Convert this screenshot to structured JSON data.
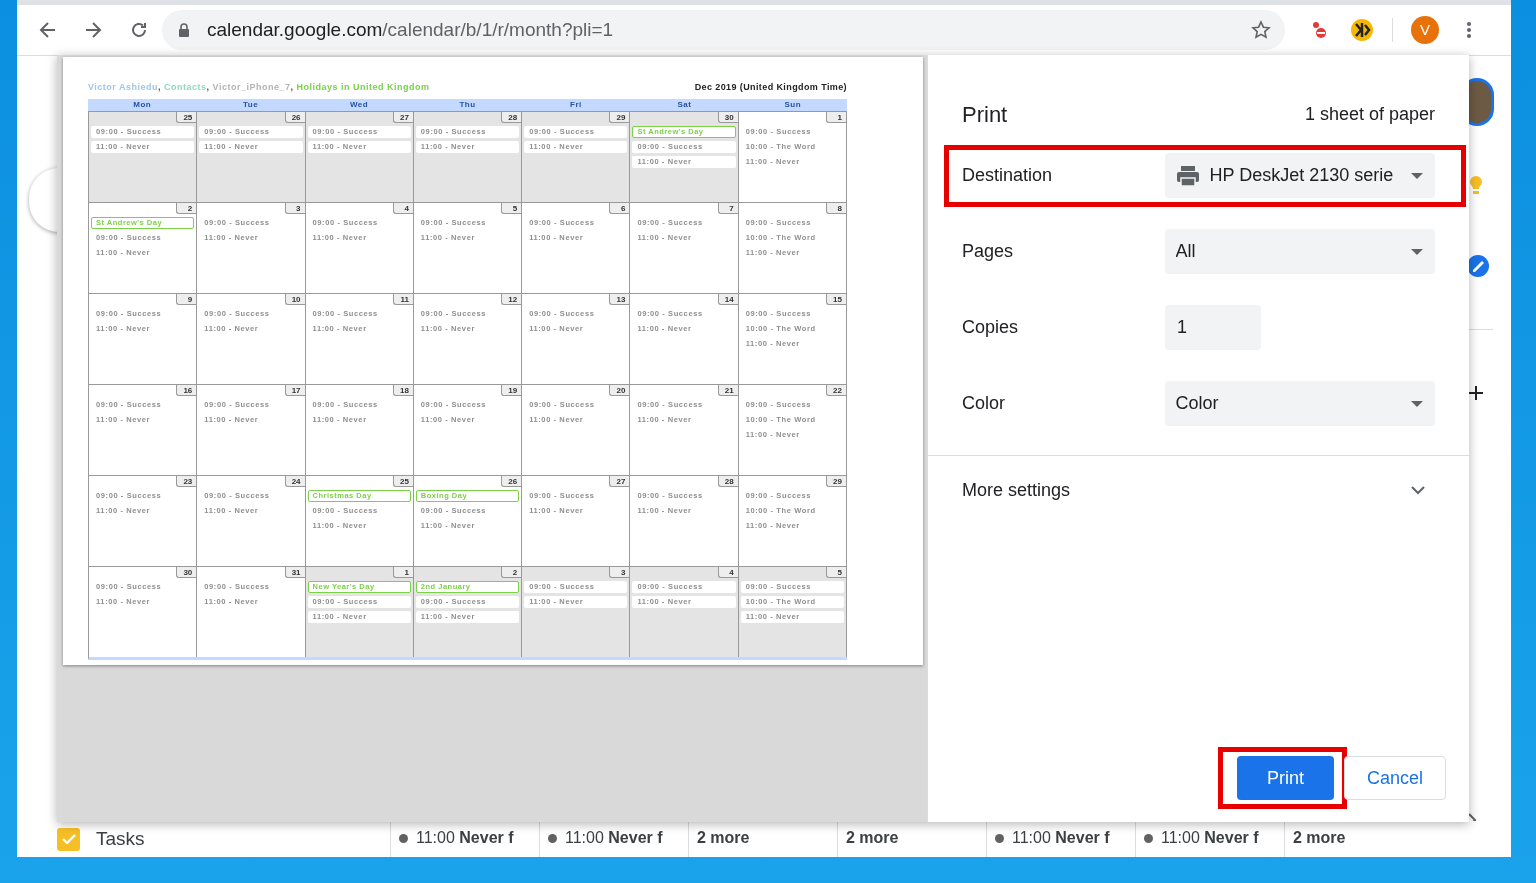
{
  "browser": {
    "url_host": "calendar.google.com",
    "url_path": "/calendar/b/1/r/month?pli=1",
    "profile_initial": "V"
  },
  "preview": {
    "calendars": [
      {
        "name": "Victor Ashiedu",
        "color": "#9fc6e7"
      },
      {
        "name": "Contacts",
        "color": "#8ed9c3"
      },
      {
        "name": "Victor_iPhone_7",
        "color": "#b3b3b3"
      },
      {
        "name": "Holidays in United Kingdom",
        "color": "#7bd148"
      }
    ],
    "calendar_separator": ", ",
    "month_title": "Dec 2019 (United Kingdom Time)",
    "weekdays": [
      "Mon",
      "Tue",
      "Wed",
      "Thu",
      "Fri",
      "Sat",
      "Sun"
    ],
    "weeks": [
      [
        {
          "date": "25",
          "other_month": true,
          "events": [
            {
              "kind": "event",
              "text": "09:00 - Success"
            },
            {
              "kind": "event",
              "text": "11:00 - Never"
            }
          ]
        },
        {
          "date": "26",
          "other_month": true,
          "events": [
            {
              "kind": "event",
              "text": "09:00 - Success"
            },
            {
              "kind": "event",
              "text": "11:00 - Never"
            }
          ]
        },
        {
          "date": "27",
          "other_month": true,
          "events": [
            {
              "kind": "event",
              "text": "09:00 - Success"
            },
            {
              "kind": "event",
              "text": "11:00 - Never"
            }
          ]
        },
        {
          "date": "28",
          "other_month": true,
          "events": [
            {
              "kind": "event",
              "text": "09:00 - Success"
            },
            {
              "kind": "event",
              "text": "11:00 - Never"
            }
          ]
        },
        {
          "date": "29",
          "other_month": true,
          "events": [
            {
              "kind": "event",
              "text": "09:00 - Success"
            },
            {
              "kind": "event",
              "text": "11:00 - Never"
            }
          ]
        },
        {
          "date": "30",
          "other_month": true,
          "events": [
            {
              "kind": "holiday",
              "text": "St Andrew's Day"
            },
            {
              "kind": "event",
              "text": "09:00 - Success"
            },
            {
              "kind": "event",
              "text": "11:00 - Never"
            }
          ]
        },
        {
          "date": "1",
          "other_month": false,
          "events": [
            {
              "kind": "event",
              "text": "09:00 - Success"
            },
            {
              "kind": "event",
              "text": "10:00 - The Word"
            },
            {
              "kind": "event",
              "text": "11:00 - Never"
            }
          ]
        }
      ],
      [
        {
          "date": "2",
          "other_month": false,
          "events": [
            {
              "kind": "holiday",
              "text": "St Andrew's Day"
            },
            {
              "kind": "event",
              "text": "09:00 - Success"
            },
            {
              "kind": "event",
              "text": "11:00 - Never"
            }
          ]
        },
        {
          "date": "3",
          "other_month": false,
          "events": [
            {
              "kind": "event",
              "text": "09:00 - Success"
            },
            {
              "kind": "event",
              "text": "11:00 - Never"
            }
          ]
        },
        {
          "date": "4",
          "other_month": false,
          "events": [
            {
              "kind": "event",
              "text": "09:00 - Success"
            },
            {
              "kind": "event",
              "text": "11:00 - Never"
            }
          ]
        },
        {
          "date": "5",
          "other_month": false,
          "events": [
            {
              "kind": "event",
              "text": "09:00 - Success"
            },
            {
              "kind": "event",
              "text": "11:00 - Never"
            }
          ]
        },
        {
          "date": "6",
          "other_month": false,
          "events": [
            {
              "kind": "event",
              "text": "09:00 - Success"
            },
            {
              "kind": "event",
              "text": "11:00 - Never"
            }
          ]
        },
        {
          "date": "7",
          "other_month": false,
          "events": [
            {
              "kind": "event",
              "text": "09:00 - Success"
            },
            {
              "kind": "event",
              "text": "11:00 - Never"
            }
          ]
        },
        {
          "date": "8",
          "other_month": false,
          "events": [
            {
              "kind": "event",
              "text": "09:00 - Success"
            },
            {
              "kind": "event",
              "text": "10:00 - The Word"
            },
            {
              "kind": "event",
              "text": "11:00 - Never"
            }
          ]
        }
      ],
      [
        {
          "date": "9",
          "other_month": false,
          "events": [
            {
              "kind": "event",
              "text": "09:00 - Success"
            },
            {
              "kind": "event",
              "text": "11:00 - Never"
            }
          ]
        },
        {
          "date": "10",
          "other_month": false,
          "events": [
            {
              "kind": "event",
              "text": "09:00 - Success"
            },
            {
              "kind": "event",
              "text": "11:00 - Never"
            }
          ]
        },
        {
          "date": "11",
          "other_month": false,
          "events": [
            {
              "kind": "event",
              "text": "09:00 - Success"
            },
            {
              "kind": "event",
              "text": "11:00 - Never"
            }
          ]
        },
        {
          "date": "12",
          "other_month": false,
          "events": [
            {
              "kind": "event",
              "text": "09:00 - Success"
            },
            {
              "kind": "event",
              "text": "11:00 - Never"
            }
          ]
        },
        {
          "date": "13",
          "other_month": false,
          "events": [
            {
              "kind": "event",
              "text": "09:00 - Success"
            },
            {
              "kind": "event",
              "text": "11:00 - Never"
            }
          ]
        },
        {
          "date": "14",
          "other_month": false,
          "events": [
            {
              "kind": "event",
              "text": "09:00 - Success"
            },
            {
              "kind": "event",
              "text": "11:00 - Never"
            }
          ]
        },
        {
          "date": "15",
          "other_month": false,
          "events": [
            {
              "kind": "event",
              "text": "09:00 - Success"
            },
            {
              "kind": "event",
              "text": "10:00 - The Word"
            },
            {
              "kind": "event",
              "text": "11:00 - Never"
            }
          ]
        }
      ],
      [
        {
          "date": "16",
          "other_month": false,
          "events": [
            {
              "kind": "event",
              "text": "09:00 - Success"
            },
            {
              "kind": "event",
              "text": "11:00 - Never"
            }
          ]
        },
        {
          "date": "17",
          "other_month": false,
          "events": [
            {
              "kind": "event",
              "text": "09:00 - Success"
            },
            {
              "kind": "event",
              "text": "11:00 - Never"
            }
          ]
        },
        {
          "date": "18",
          "other_month": false,
          "events": [
            {
              "kind": "event",
              "text": "09:00 - Success"
            },
            {
              "kind": "event",
              "text": "11:00 - Never"
            }
          ]
        },
        {
          "date": "19",
          "other_month": false,
          "events": [
            {
              "kind": "event",
              "text": "09:00 - Success"
            },
            {
              "kind": "event",
              "text": "11:00 - Never"
            }
          ]
        },
        {
          "date": "20",
          "other_month": false,
          "events": [
            {
              "kind": "event",
              "text": "09:00 - Success"
            },
            {
              "kind": "event",
              "text": "11:00 - Never"
            }
          ]
        },
        {
          "date": "21",
          "other_month": false,
          "events": [
            {
              "kind": "event",
              "text": "09:00 - Success"
            },
            {
              "kind": "event",
              "text": "11:00 - Never"
            }
          ]
        },
        {
          "date": "22",
          "other_month": false,
          "events": [
            {
              "kind": "event",
              "text": "09:00 - Success"
            },
            {
              "kind": "event",
              "text": "10:00 - The Word"
            },
            {
              "kind": "event",
              "text": "11:00 - Never"
            }
          ]
        }
      ],
      [
        {
          "date": "23",
          "other_month": false,
          "events": [
            {
              "kind": "event",
              "text": "09:00 - Success"
            },
            {
              "kind": "event",
              "text": "11:00 - Never"
            }
          ]
        },
        {
          "date": "24",
          "other_month": false,
          "events": [
            {
              "kind": "event",
              "text": "09:00 - Success"
            },
            {
              "kind": "event",
              "text": "11:00 - Never"
            }
          ]
        },
        {
          "date": "25",
          "other_month": false,
          "events": [
            {
              "kind": "holiday",
              "text": "Christmas Day"
            },
            {
              "kind": "event",
              "text": "09:00 - Success"
            },
            {
              "kind": "event",
              "text": "11:00 - Never"
            }
          ]
        },
        {
          "date": "26",
          "other_month": false,
          "events": [
            {
              "kind": "holiday",
              "text": "Boxing Day"
            },
            {
              "kind": "event",
              "text": "09:00 - Success"
            },
            {
              "kind": "event",
              "text": "11:00 - Never"
            }
          ]
        },
        {
          "date": "27",
          "other_month": false,
          "events": [
            {
              "kind": "event",
              "text": "09:00 - Success"
            },
            {
              "kind": "event",
              "text": "11:00 - Never"
            }
          ]
        },
        {
          "date": "28",
          "other_month": false,
          "events": [
            {
              "kind": "event",
              "text": "09:00 - Success"
            },
            {
              "kind": "event",
              "text": "11:00 - Never"
            }
          ]
        },
        {
          "date": "29",
          "other_month": false,
          "events": [
            {
              "kind": "event",
              "text": "09:00 - Success"
            },
            {
              "kind": "event",
              "text": "10:00 - The Word"
            },
            {
              "kind": "event",
              "text": "11:00 - Never"
            }
          ]
        }
      ],
      [
        {
          "date": "30",
          "other_month": false,
          "events": [
            {
              "kind": "event",
              "text": "09:00 - Success"
            },
            {
              "kind": "event",
              "text": "11:00 - Never"
            }
          ]
        },
        {
          "date": "31",
          "other_month": false,
          "events": [
            {
              "kind": "event",
              "text": "09:00 - Success"
            },
            {
              "kind": "event",
              "text": "11:00 - Never"
            }
          ]
        },
        {
          "date": "1",
          "other_month": true,
          "events": [
            {
              "kind": "holiday",
              "text": "New Year's Day"
            },
            {
              "kind": "event",
              "text": "09:00 - Success"
            },
            {
              "kind": "event",
              "text": "11:00 - Never"
            }
          ]
        },
        {
          "date": "2",
          "other_month": true,
          "events": [
            {
              "kind": "holiday",
              "text": "2nd January"
            },
            {
              "kind": "event",
              "text": "09:00 - Success"
            },
            {
              "kind": "event",
              "text": "11:00 - Never"
            }
          ]
        },
        {
          "date": "3",
          "other_month": true,
          "events": [
            {
              "kind": "event",
              "text": "09:00 - Success"
            },
            {
              "kind": "event",
              "text": "11:00 - Never"
            }
          ]
        },
        {
          "date": "4",
          "other_month": true,
          "events": [
            {
              "kind": "event",
              "text": "09:00 - Success"
            },
            {
              "kind": "event",
              "text": "11:00 - Never"
            }
          ]
        },
        {
          "date": "5",
          "other_month": true,
          "events": [
            {
              "kind": "event",
              "text": "09:00 - Success"
            },
            {
              "kind": "event",
              "text": "10:00 - The Word"
            },
            {
              "kind": "event",
              "text": "11:00 - Never"
            }
          ]
        }
      ]
    ]
  },
  "print_panel": {
    "title": "Print",
    "sheet_count": "1 sheet of paper",
    "settings": [
      {
        "kind": "printer",
        "label": "Destination",
        "value": "HP DeskJet 2130 serie",
        "highlighted": true
      },
      {
        "kind": "dropdown",
        "label": "Pages",
        "value": "All",
        "highlighted": false
      },
      {
        "kind": "input",
        "label": "Copies",
        "value": "1",
        "highlighted": false
      },
      {
        "kind": "dropdown",
        "label": "Color",
        "value": "Color",
        "highlighted": false
      }
    ],
    "more_settings": {
      "label": "More settings",
      "expanded": false
    },
    "buttons": [
      {
        "kind": "primary",
        "label": "Print",
        "highlighted": true
      },
      {
        "kind": "secondary",
        "label": "Cancel",
        "highlighted": false
      }
    ]
  },
  "calendar_bottom": {
    "tasks_label": "Tasks",
    "tasks_checked": true,
    "cells": [
      {
        "kind": "event",
        "time": "11:00",
        "title": "Never f"
      },
      {
        "kind": "event",
        "time": "11:00",
        "title": "Never f"
      },
      {
        "kind": "more",
        "text": "2 more"
      },
      {
        "kind": "more",
        "text": "2 more"
      },
      {
        "kind": "event",
        "time": "11:00",
        "title": "Never f"
      },
      {
        "kind": "event",
        "time": "11:00",
        "title": "Never f"
      },
      {
        "kind": "more",
        "text": "2 more"
      }
    ]
  }
}
